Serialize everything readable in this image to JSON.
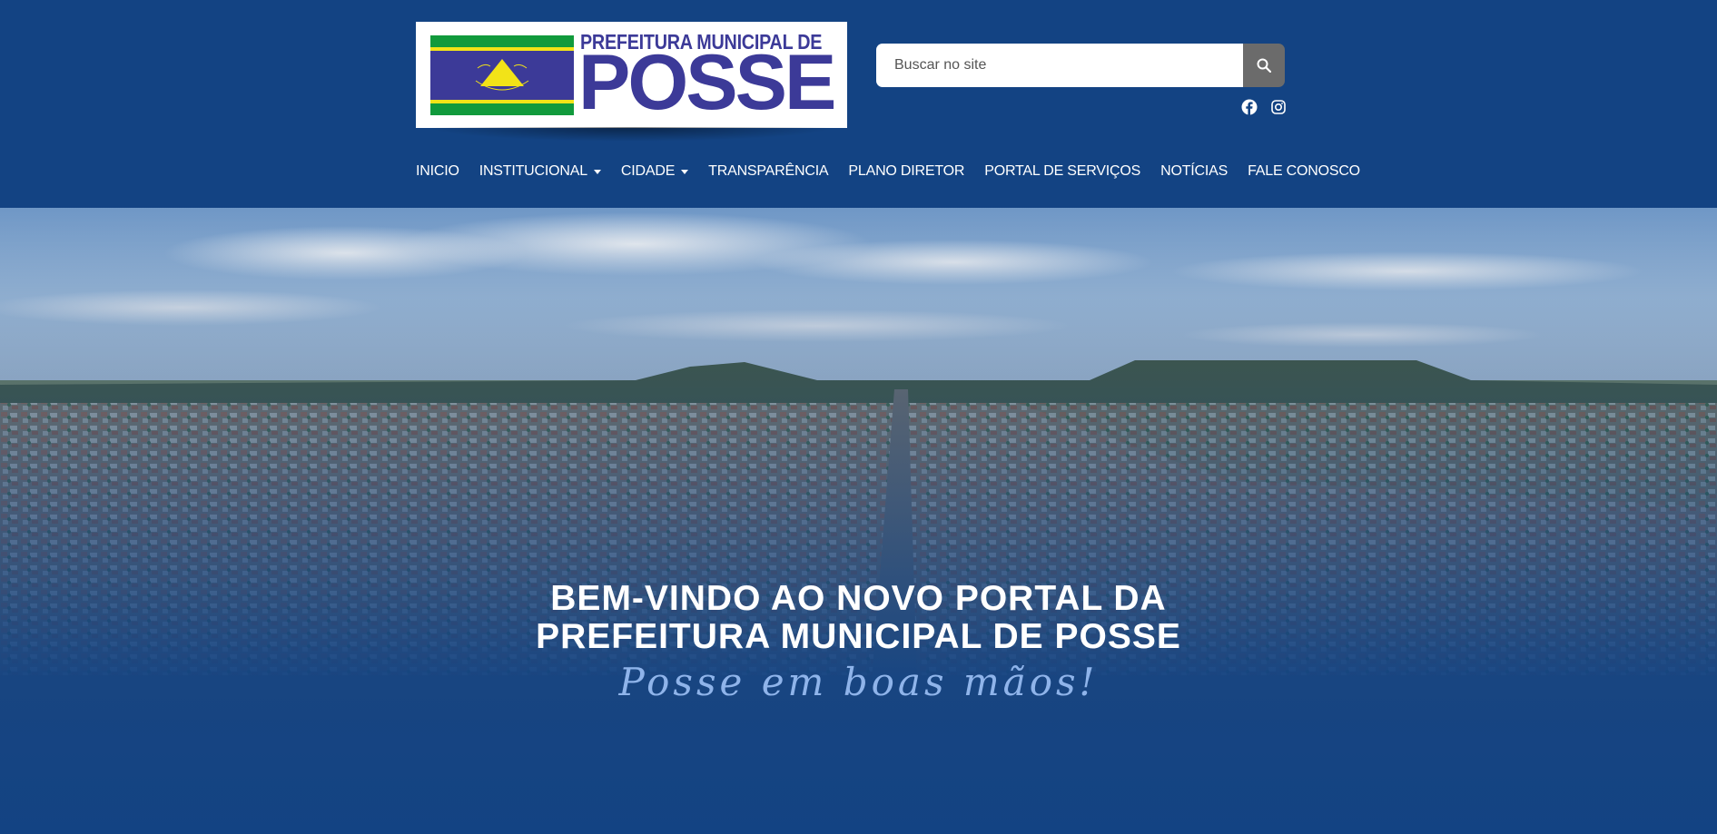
{
  "logo": {
    "line1": "PREFEITURA MUNICIPAL DE",
    "line2": "POSSE",
    "flag_colors": [
      "#119a3c",
      "#f2e318",
      "#3c3a98"
    ]
  },
  "search": {
    "placeholder": "Buscar no site",
    "value": "",
    "icon": "search-icon"
  },
  "social": [
    {
      "name": "facebook",
      "icon": "facebook-icon"
    },
    {
      "name": "instagram",
      "icon": "instagram-icon"
    }
  ],
  "nav": {
    "items": [
      {
        "label": "INICIO",
        "dropdown": false
      },
      {
        "label": "INSTITUCIONAL",
        "dropdown": true
      },
      {
        "label": "CIDADE",
        "dropdown": true
      },
      {
        "label": "TRANSPARÊNCIA",
        "dropdown": false
      },
      {
        "label": "PLANO DIRETOR",
        "dropdown": false
      },
      {
        "label": "PORTAL DE SERVIÇOS",
        "dropdown": false
      },
      {
        "label": "NOTÍCIAS",
        "dropdown": false
      },
      {
        "label": "FALE CONOSCO",
        "dropdown": false
      }
    ]
  },
  "hero": {
    "title_line1": "BEM-VINDO AO NOVO PORTAL DA",
    "title_line2": "PREFEITURA MUNICIPAL DE POSSE",
    "slogan": "Posse em boas mãos!"
  },
  "colors": {
    "header_bg": "#134383",
    "logo_text": "#3c3a98",
    "search_button": "#6b6b6b",
    "slogan": "#8fb4ea"
  }
}
